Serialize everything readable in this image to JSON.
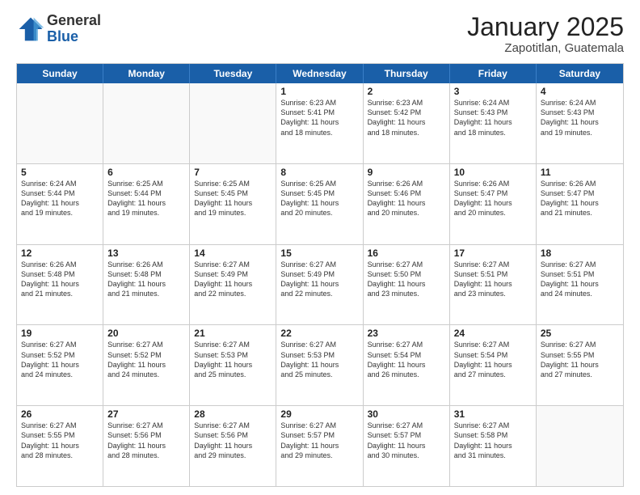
{
  "logo": {
    "general": "General",
    "blue": "Blue"
  },
  "header": {
    "month": "January 2025",
    "location": "Zapotitlan, Guatemala"
  },
  "days": [
    "Sunday",
    "Monday",
    "Tuesday",
    "Wednesday",
    "Thursday",
    "Friday",
    "Saturday"
  ],
  "weeks": [
    [
      {
        "day": "",
        "content": ""
      },
      {
        "day": "",
        "content": ""
      },
      {
        "day": "",
        "content": ""
      },
      {
        "day": "1",
        "content": "Sunrise: 6:23 AM\nSunset: 5:41 PM\nDaylight: 11 hours\nand 18 minutes."
      },
      {
        "day": "2",
        "content": "Sunrise: 6:23 AM\nSunset: 5:42 PM\nDaylight: 11 hours\nand 18 minutes."
      },
      {
        "day": "3",
        "content": "Sunrise: 6:24 AM\nSunset: 5:43 PM\nDaylight: 11 hours\nand 18 minutes."
      },
      {
        "day": "4",
        "content": "Sunrise: 6:24 AM\nSunset: 5:43 PM\nDaylight: 11 hours\nand 19 minutes."
      }
    ],
    [
      {
        "day": "5",
        "content": "Sunrise: 6:24 AM\nSunset: 5:44 PM\nDaylight: 11 hours\nand 19 minutes."
      },
      {
        "day": "6",
        "content": "Sunrise: 6:25 AM\nSunset: 5:44 PM\nDaylight: 11 hours\nand 19 minutes."
      },
      {
        "day": "7",
        "content": "Sunrise: 6:25 AM\nSunset: 5:45 PM\nDaylight: 11 hours\nand 19 minutes."
      },
      {
        "day": "8",
        "content": "Sunrise: 6:25 AM\nSunset: 5:45 PM\nDaylight: 11 hours\nand 20 minutes."
      },
      {
        "day": "9",
        "content": "Sunrise: 6:26 AM\nSunset: 5:46 PM\nDaylight: 11 hours\nand 20 minutes."
      },
      {
        "day": "10",
        "content": "Sunrise: 6:26 AM\nSunset: 5:47 PM\nDaylight: 11 hours\nand 20 minutes."
      },
      {
        "day": "11",
        "content": "Sunrise: 6:26 AM\nSunset: 5:47 PM\nDaylight: 11 hours\nand 21 minutes."
      }
    ],
    [
      {
        "day": "12",
        "content": "Sunrise: 6:26 AM\nSunset: 5:48 PM\nDaylight: 11 hours\nand 21 minutes."
      },
      {
        "day": "13",
        "content": "Sunrise: 6:26 AM\nSunset: 5:48 PM\nDaylight: 11 hours\nand 21 minutes."
      },
      {
        "day": "14",
        "content": "Sunrise: 6:27 AM\nSunset: 5:49 PM\nDaylight: 11 hours\nand 22 minutes."
      },
      {
        "day": "15",
        "content": "Sunrise: 6:27 AM\nSunset: 5:49 PM\nDaylight: 11 hours\nand 22 minutes."
      },
      {
        "day": "16",
        "content": "Sunrise: 6:27 AM\nSunset: 5:50 PM\nDaylight: 11 hours\nand 23 minutes."
      },
      {
        "day": "17",
        "content": "Sunrise: 6:27 AM\nSunset: 5:51 PM\nDaylight: 11 hours\nand 23 minutes."
      },
      {
        "day": "18",
        "content": "Sunrise: 6:27 AM\nSunset: 5:51 PM\nDaylight: 11 hours\nand 24 minutes."
      }
    ],
    [
      {
        "day": "19",
        "content": "Sunrise: 6:27 AM\nSunset: 5:52 PM\nDaylight: 11 hours\nand 24 minutes."
      },
      {
        "day": "20",
        "content": "Sunrise: 6:27 AM\nSunset: 5:52 PM\nDaylight: 11 hours\nand 24 minutes."
      },
      {
        "day": "21",
        "content": "Sunrise: 6:27 AM\nSunset: 5:53 PM\nDaylight: 11 hours\nand 25 minutes."
      },
      {
        "day": "22",
        "content": "Sunrise: 6:27 AM\nSunset: 5:53 PM\nDaylight: 11 hours\nand 25 minutes."
      },
      {
        "day": "23",
        "content": "Sunrise: 6:27 AM\nSunset: 5:54 PM\nDaylight: 11 hours\nand 26 minutes."
      },
      {
        "day": "24",
        "content": "Sunrise: 6:27 AM\nSunset: 5:54 PM\nDaylight: 11 hours\nand 27 minutes."
      },
      {
        "day": "25",
        "content": "Sunrise: 6:27 AM\nSunset: 5:55 PM\nDaylight: 11 hours\nand 27 minutes."
      }
    ],
    [
      {
        "day": "26",
        "content": "Sunrise: 6:27 AM\nSunset: 5:55 PM\nDaylight: 11 hours\nand 28 minutes."
      },
      {
        "day": "27",
        "content": "Sunrise: 6:27 AM\nSunset: 5:56 PM\nDaylight: 11 hours\nand 28 minutes."
      },
      {
        "day": "28",
        "content": "Sunrise: 6:27 AM\nSunset: 5:56 PM\nDaylight: 11 hours\nand 29 minutes."
      },
      {
        "day": "29",
        "content": "Sunrise: 6:27 AM\nSunset: 5:57 PM\nDaylight: 11 hours\nand 29 minutes."
      },
      {
        "day": "30",
        "content": "Sunrise: 6:27 AM\nSunset: 5:57 PM\nDaylight: 11 hours\nand 30 minutes."
      },
      {
        "day": "31",
        "content": "Sunrise: 6:27 AM\nSunset: 5:58 PM\nDaylight: 11 hours\nand 31 minutes."
      },
      {
        "day": "",
        "content": ""
      }
    ]
  ]
}
